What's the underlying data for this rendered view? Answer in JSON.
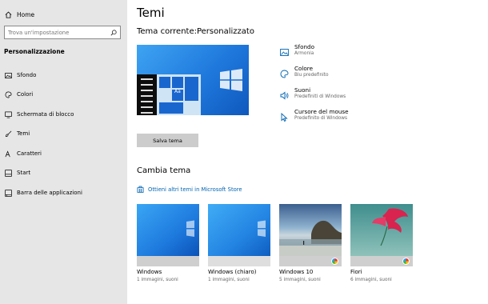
{
  "sidebar": {
    "home_label": "Home",
    "search_placeholder": "Trova un'impostazione",
    "section_title": "Personalizzazione",
    "items": [
      {
        "label": "Sfondo",
        "icon": "picture-icon"
      },
      {
        "label": "Colori",
        "icon": "palette-icon"
      },
      {
        "label": "Schermata di blocco",
        "icon": "lock-screen-icon"
      },
      {
        "label": "Temi",
        "icon": "brush-icon"
      },
      {
        "label": "Caratteri",
        "icon": "font-icon"
      },
      {
        "label": "Start",
        "icon": "start-icon"
      },
      {
        "label": "Barra delle applicazioni",
        "icon": "taskbar-icon"
      }
    ]
  },
  "main": {
    "title": "Temi",
    "current_theme": "Tema corrente:Personalizzato",
    "preview_text": "Aa",
    "properties": [
      {
        "name": "Sfondo",
        "value": "Armonia",
        "icon": "picture-icon"
      },
      {
        "name": "Colore",
        "value": "Blu predefinito",
        "icon": "palette-icon"
      },
      {
        "name": "Suoni",
        "value": "Predefiniti di Windows",
        "icon": "speaker-icon"
      },
      {
        "name": "Cursore del mouse",
        "value": "Predefinito di Windows",
        "icon": "cursor-icon"
      }
    ],
    "save_label": "Salva tema",
    "change_title": "Cambia tema",
    "store_link": "Ottieni altri temi in Microsoft Store",
    "themes": [
      {
        "name": "Windows",
        "count": "1 immagini, suoni"
      },
      {
        "name": "Windows (chiaro)",
        "count": "1 immagini, suoni"
      },
      {
        "name": "Windows 10",
        "count": "5 immagini, suoni"
      },
      {
        "name": "Fiori",
        "count": "6 immagini, suoni"
      }
    ]
  },
  "colors": {
    "accent": "#0063b1",
    "sidebar_bg": "#e6e6e6"
  }
}
